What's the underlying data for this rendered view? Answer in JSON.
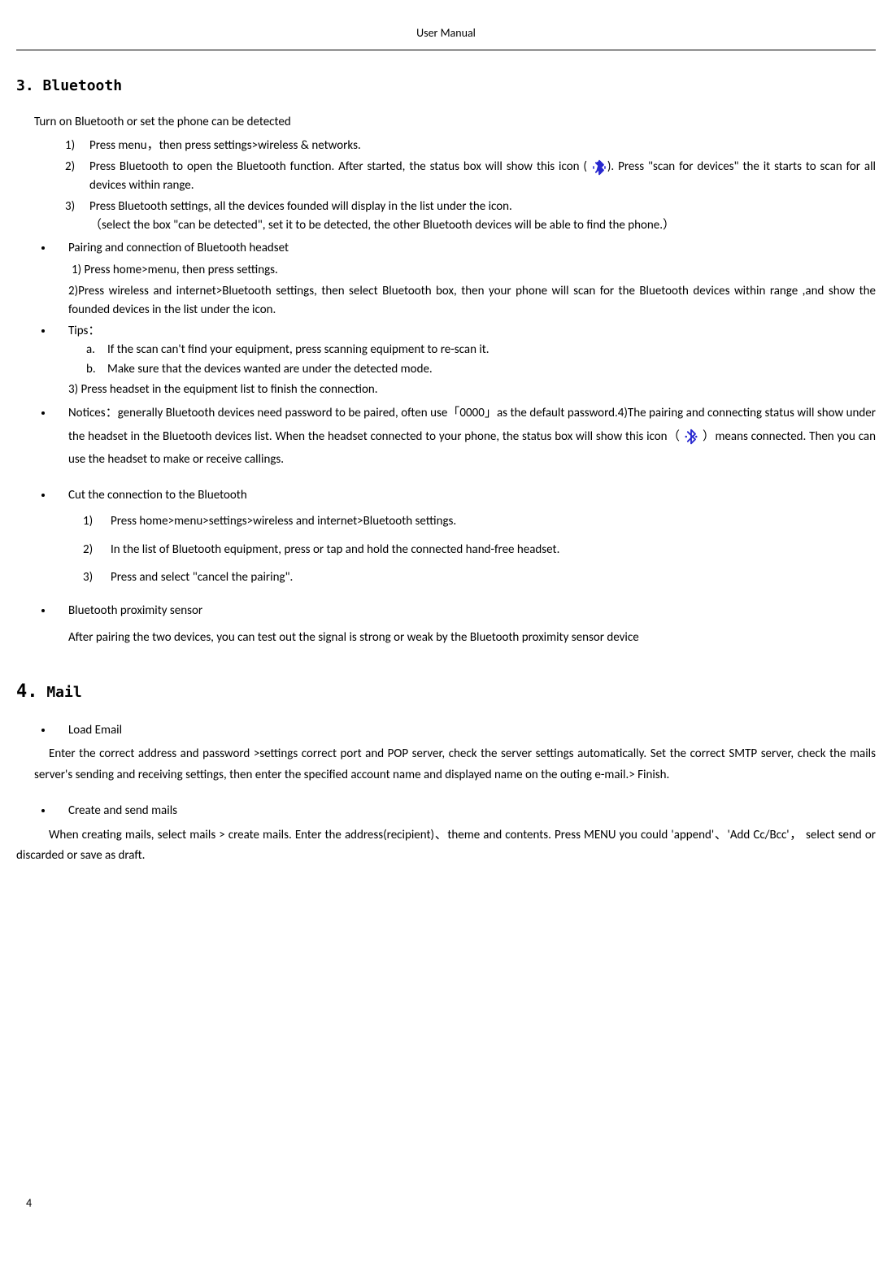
{
  "header": "User Manual",
  "pageNumber": "4",
  "section3": {
    "number": "3.",
    "title": "Bluetooth",
    "intro": "Turn on Bluetooth or set the phone can be detected",
    "steps": {
      "s1n": "1)",
      "s1": "Press menu，then press settings>wireless & networks.",
      "s2n": "2)",
      "s2a": "Press Bluetooth to open the Bluetooth function. After started, the status box will show this icon (",
      "s2b": "). Press  \"scan for devices\" the it starts to scan for all devices within range.",
      "s3n": "3)",
      "s3a": "Press Bluetooth settings, all the devices founded will display in the list under the icon.",
      "s3b": "（select the box \"can be detected\", set it to be detected, the other Bluetooth devices will be able to find the phone.）"
    },
    "pairing": {
      "title": "Pairing and connection of Bluetooth headset",
      "line1": "1) Press home>menu, then press settings.",
      "line2": "2)Press wireless and internet>Bluetooth settings, then select Bluetooth box, then your phone will scan for the Bluetooth devices within range ,and show the founded devices in the list under the icon."
    },
    "tips": {
      "title": "Tips：",
      "a_l": "a.",
      "a": "If the scan can't find your equipment, press scanning equipment to re-scan it.",
      "b_l": "b.",
      "b": "Make sure that the devices wanted are under the detected mode.",
      "line3": "3) Press headset in the equipment list to finish the connection."
    },
    "notices": {
      "part1": "Notices：generally Bluetooth devices need password to be paired, often use「0000」as the default password.4)The pairing and connecting status will show under the headset in the Bluetooth devices list. When the headset connected to your phone, the status box will show this icon（",
      "part2": "）means connected. Then you can use the headset to make or receive callings."
    },
    "cut": {
      "title": "Cut the connection to the Bluetooth",
      "s1n": "1)",
      "s1": "Press home>menu>settings>wireless and internet>Bluetooth settings.",
      "s2n": "2)",
      "s2": "In the list of Bluetooth equipment, press or tap and hold the connected hand-free headset.",
      "s3n": "3)",
      "s3": "Press and select \"cancel the pairing\"."
    },
    "proximity": {
      "title": "Bluetooth proximity sensor",
      "body": "After pairing the two devices, you can test out the signal is strong or weak by the Bluetooth proximity sensor device"
    }
  },
  "section4": {
    "number": "4.",
    "title": "Mail",
    "load": {
      "title": "Load Email",
      "body": "Enter the correct address and password >settings correct port and POP server, check the server settings automatically. Set the correct SMTP server, check the mails server's sending and receiving settings, then enter the specified account name and displayed name on the outing e-mail.>   Finish."
    },
    "create": {
      "title": "Create and send mails",
      "body": "When creating mails, select mails > create mails. Enter the address(recipient)、theme and contents. Press MENU you could  'append'、'Add Cc/Bcc'，  select send or discarded or save as draft."
    }
  }
}
